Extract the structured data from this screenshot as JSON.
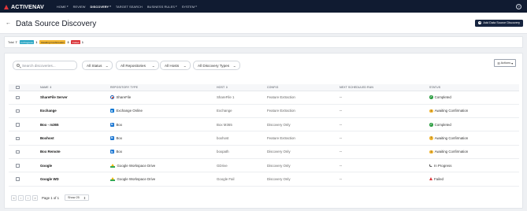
{
  "brand": {
    "name": "ACTIVENAV",
    "mark_color": "#e0353a"
  },
  "nav": {
    "items": [
      {
        "label": "HOME",
        "caret": true
      },
      {
        "label": "REVIEW",
        "caret": false
      },
      {
        "label": "DISCOVERY",
        "caret": true,
        "active": true
      },
      {
        "label": "TARGET SEARCH",
        "caret": false
      },
      {
        "label": "BUSINESS RULES",
        "caret": true
      },
      {
        "label": "SYSTEM",
        "caret": true
      }
    ],
    "help_icon": "?"
  },
  "header": {
    "back_icon": "←",
    "title": "Data Source Discovery",
    "add_button": "Add Data Source Discovery"
  },
  "summary": {
    "total_label": "Total",
    "total_count": "7",
    "in_progress_label": "In Progress",
    "in_progress_count": "1",
    "awaiting_label": "Awaiting Confirmation",
    "awaiting_count": "3",
    "failed_label": "Failed",
    "failed_count": "1"
  },
  "toolbar": {
    "search_placeholder": "Search discoveries...",
    "filters": [
      "All Status",
      "All Repositories",
      "All Hosts",
      "All Discovery Types"
    ],
    "actions_label": "Actions"
  },
  "table": {
    "columns": [
      "NAME",
      "REPOSITORY TYPE",
      "HOST",
      "CONFIG",
      "NEXT SCHEDULED RUN",
      "STATUS"
    ],
    "rows": [
      {
        "name": "ShareFile Server",
        "repo": "ShareFile",
        "repo_icon": "sharefile",
        "host": "ShareFile 1",
        "config": "Feature Extraction",
        "next_run": "--",
        "status": "Completed",
        "status_icon": "completed"
      },
      {
        "name": "Exchange",
        "repo": "Exchange Online",
        "repo_icon": "exchange",
        "host": "Exchange",
        "config": "Feature Extraction",
        "next_run": "--",
        "status": "Awaiting Confirmation",
        "status_icon": "awaiting"
      },
      {
        "name": "Box - m365",
        "repo": "Box",
        "repo_icon": "box",
        "host": "Box M365",
        "config": "Discovery Only",
        "next_run": "--",
        "status": "Completed",
        "status_icon": "completed"
      },
      {
        "name": "Boxhost",
        "repo": "Box",
        "repo_icon": "box",
        "host": "boxhost",
        "config": "Feature Extraction",
        "next_run": "--",
        "status": "Awaiting Confirmation",
        "status_icon": "awaiting"
      },
      {
        "name": "Box Remote",
        "repo": "Box",
        "repo_icon": "box",
        "host": "boxpath",
        "config": "Discovery Only",
        "next_run": "--",
        "status": "Awaiting Confirmation",
        "status_icon": "awaiting"
      },
      {
        "name": "Google",
        "repo": "Google Workspace Drive",
        "repo_icon": "gdrive",
        "host": "GDrive",
        "config": "Discovery Only",
        "next_run": "--",
        "status": "In Progress",
        "status_icon": "progress"
      },
      {
        "name": "Google WD",
        "repo": "Google Workspace Drive",
        "repo_icon": "gdrive",
        "host": "Google Fail",
        "config": "Discovery Only",
        "next_run": "--",
        "status": "Failed",
        "status_icon": "failed"
      }
    ]
  },
  "pagination": {
    "first": "«",
    "prev": "‹",
    "next": "›",
    "last": "»",
    "page_label": "Page 1 of 1",
    "show_label": "Show 25"
  },
  "colors": {
    "nav_bg": "#101b31",
    "primary_button": "#16243f",
    "completed": "#2f9e44",
    "awaiting": "#f2b632",
    "in_progress": "#2aa6c4",
    "failed": "#d9353a"
  }
}
